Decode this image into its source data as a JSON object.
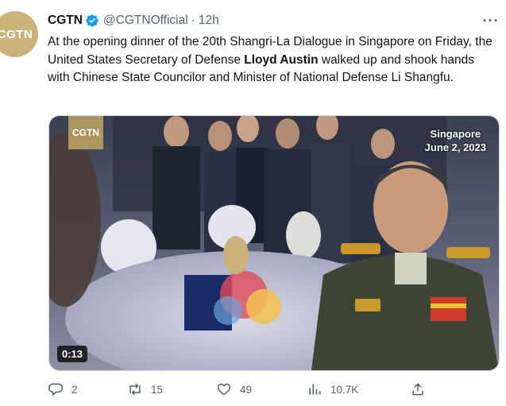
{
  "author": {
    "name": "CGTN",
    "handle": "@CGTNOfficial",
    "separator": "·",
    "time": "12h",
    "avatar_text": "CGTN"
  },
  "tweet": {
    "text_part1": "At the opening dinner of the 20th Shangri-La Dialogue in Singapore on Friday, the United States Secretary of Defense ",
    "text_bold": "Lloyd Austin",
    "text_part2": " walked up and shook hands with Chinese State Councilor and Minister of National Defense Li Shangfu."
  },
  "video": {
    "watermark": "CGTN",
    "location": "Singapore",
    "date": "June 2, 2023",
    "duration": "0:13"
  },
  "actions": {
    "replies": "2",
    "retweets": "15",
    "likes": "49",
    "views": "10.7K"
  },
  "colors": {
    "verified": "#1d9bf0",
    "muted": "#536471"
  }
}
